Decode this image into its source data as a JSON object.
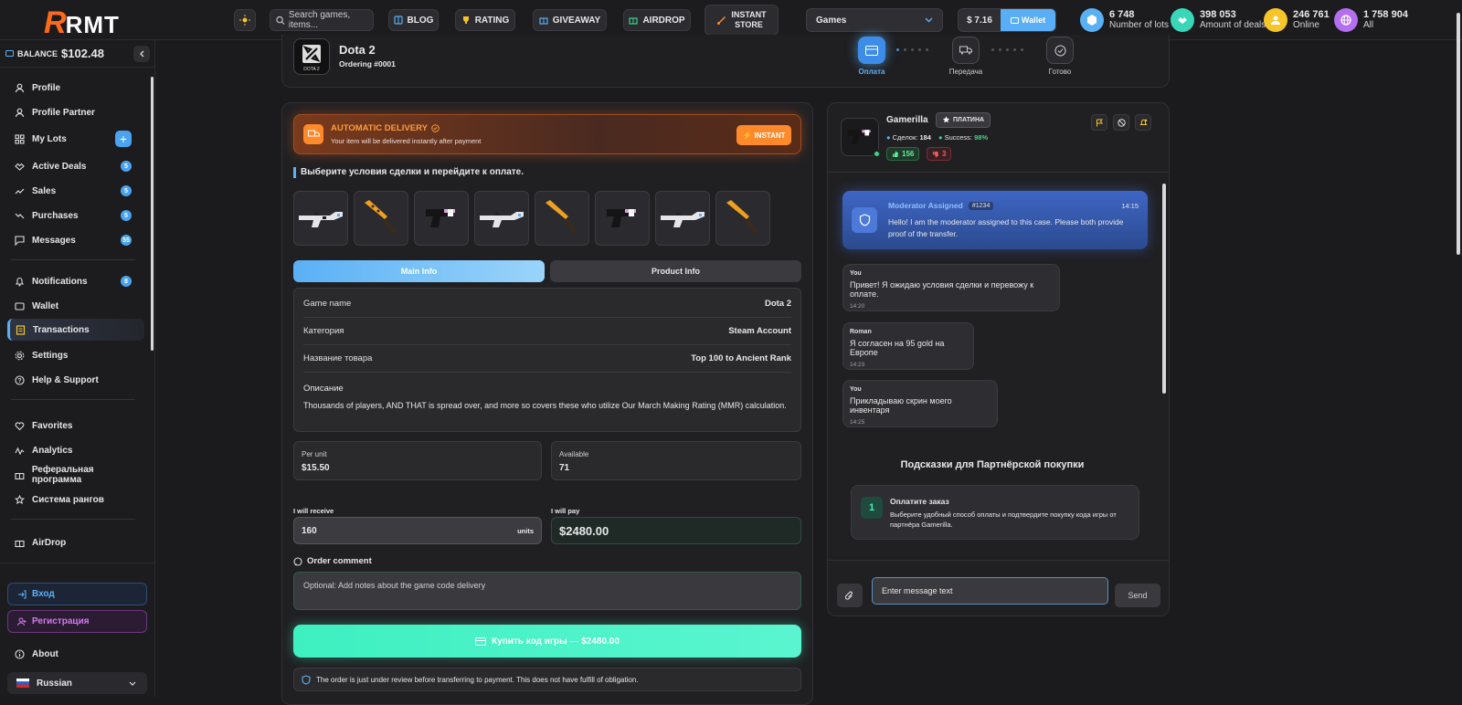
{
  "brand": {
    "logo_text": "RMT",
    "logo_initial": "R"
  },
  "topbar": {
    "search_placeholder": "Search games, items...",
    "nav": [
      "BLOG",
      "RATING",
      "GIVEAWAY",
      "AIRDROP"
    ],
    "instant_store": [
      "INSTANT",
      "STORE"
    ],
    "games_select": "Games",
    "balance": "$ 7.16",
    "wallet_label": "Wallet",
    "stats": [
      {
        "value": "6 748",
        "label": "Number of lots",
        "color": "#5ab0f5"
      },
      {
        "value": "398 053",
        "label": "Amount of deals",
        "color": "#3ad6b8"
      },
      {
        "value": "246 761",
        "label": "Online",
        "color": "#f5c52a"
      },
      {
        "value": "1 758 904",
        "label": "All",
        "color": "#b46ef0"
      }
    ]
  },
  "sidebar": {
    "balance_label": "BALANCE",
    "balance_value": "$102.48",
    "items": [
      {
        "label": "Profile",
        "icon": "user-icon"
      },
      {
        "label": "Profile Partner",
        "icon": "user-icon"
      },
      {
        "label": "My Lots",
        "icon": "grid-icon",
        "plus": "+"
      },
      {
        "label": "Active Deals",
        "icon": "handshake-icon",
        "badge": "5"
      },
      {
        "label": "Sales",
        "icon": "trend-icon",
        "badge": "5"
      },
      {
        "label": "Purchases",
        "icon": "trend-down-icon",
        "badge": "5"
      },
      {
        "label": "Messages",
        "icon": "chat-icon",
        "badge": "55"
      },
      {
        "label": "Notifications",
        "icon": "bell-icon",
        "badge": "8"
      },
      {
        "label": "Wallet",
        "icon": "wallet-icon"
      },
      {
        "label": "Transactions",
        "icon": "receipt-icon"
      },
      {
        "label": "Settings",
        "icon": "gear-icon"
      },
      {
        "label": "Help & Support",
        "icon": "help-icon"
      },
      {
        "label": "Favorites",
        "icon": "heart-icon"
      },
      {
        "label": "Analytics",
        "icon": "analytics-icon"
      },
      {
        "label": "Реферальная программа",
        "icon": "gift-icon"
      },
      {
        "label": "Система рангов",
        "icon": "star-icon"
      },
      {
        "label": "AirDrop",
        "icon": "gift-icon"
      }
    ],
    "login": "Вход",
    "register": "Регистрация",
    "about": "About",
    "language": "Russian"
  },
  "order": {
    "game": "Dota 2",
    "game_icon_text": "DOTA 2",
    "order_no": "Ordering #0001",
    "steps": [
      "Оплата",
      "Передача",
      "Готово"
    ]
  },
  "delivery": {
    "title": "AUTOMATIC DELIVERY",
    "subtitle": "Your item will be delivered instantly after payment",
    "badge": "INSTANT"
  },
  "conditions_heading": "Выберите условия сделки и перейдите к оплате.",
  "tabs": [
    "Main Info",
    "Product Info"
  ],
  "info": {
    "rows": [
      {
        "k": "Game name",
        "v": "Dota 2"
      },
      {
        "k": "Категория",
        "v": "Steam Account"
      },
      {
        "k": "Название товара",
        "v": "Top 100 to Ancient Rank"
      }
    ],
    "desc_label": "Описание",
    "desc_text": "Thousands of players, AND THAT is spread over, and more so covers these who utilize Our March Making Rating (MMR) calculation."
  },
  "fields": {
    "per_unit_label": "Per unit",
    "per_unit": "$15.50",
    "available_label": "Available",
    "available": "71",
    "receive_label": "I will receive",
    "receive": "160",
    "receive_unit": "units",
    "pay_label": "I will pay",
    "pay": "$2480.00"
  },
  "comment": {
    "label": "Order comment",
    "placeholder": "Optional: Add notes about the game code delivery"
  },
  "buy_button": "Купить код игры — $2480.00",
  "notice": "The order is just under review before transferring to payment. This does not have fulfill of obligation.",
  "seller": {
    "name": "Gamerilla",
    "tier": "ПЛАТИНА",
    "deals_label": "Сделок:",
    "deals": "184",
    "success_label": "Success:",
    "success": "98%",
    "likes": "156",
    "dislikes": "3"
  },
  "chat": {
    "moderator": {
      "title": "Moderator Assigned",
      "tag": "#1234",
      "time": "14:15",
      "text": "Hello! I am the moderator assigned to this case. Please both provide proof of the transfer."
    },
    "messages": [
      {
        "author": "You",
        "text": "Привет! Я ожидаю условия сделки и перевожу к оплате.",
        "time": "14:20"
      },
      {
        "author": "Roman",
        "text": "Я согласен на 95 gold на Европе",
        "time": "14:23"
      },
      {
        "author": "You",
        "text": "Прикладываю скрин моего инвентаря",
        "time": "14:25"
      }
    ],
    "hints_title": "Подсказки для Партнёрской покупки",
    "hint": {
      "num": "1",
      "title": "Оплатите заказ",
      "text": "Выберите удобный способ оплаты и подтвердите покупку кода игры от партнёра Gamerilla."
    },
    "input_placeholder": "Enter message text",
    "send": "Send"
  },
  "colors": {
    "accent": "#5aaef5",
    "orange": "#ff8a2b",
    "green": "#3ef0c0"
  }
}
